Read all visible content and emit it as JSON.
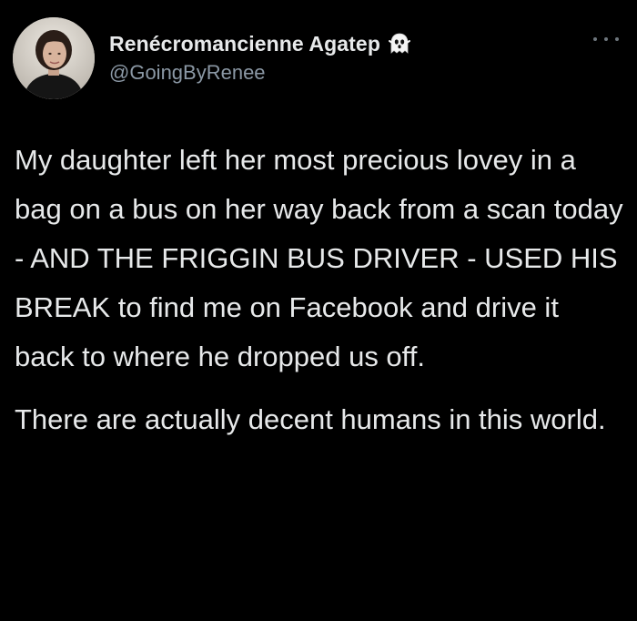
{
  "author": {
    "display_name": "Renécromancienne Agatep",
    "handle": "@GoingByRenee",
    "name_emoji": "ghost-icon"
  },
  "menu": {
    "icon": "more-horizontal-icon"
  },
  "tweet": {
    "paragraphs": [
      "My daughter left her most precious lovey in a bag on a bus on her way back from a scan today - AND THE FRIGGIN BUS DRIVER - USED HIS BREAK to find me on Facebook and drive it back to where he dropped us off.",
      "There are actually decent humans in this world."
    ]
  },
  "colors": {
    "background": "#000000",
    "text_primary": "#e7e9ea",
    "text_secondary": "#8b98a5"
  }
}
